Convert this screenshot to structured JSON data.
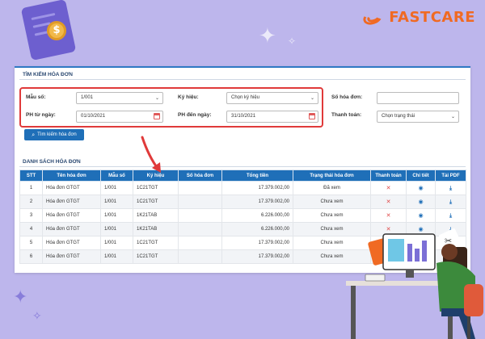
{
  "brand": {
    "name": "FASTCARE",
    "color": "#f06a23"
  },
  "search_section": {
    "title": "TÌM KIẾM HÓA ĐƠN",
    "fields": {
      "mau_so": {
        "label": "Mẫu số:",
        "value": "1/001"
      },
      "ky_hieu": {
        "label": "Ký hiệu:",
        "value": "Chọn ký hiệu"
      },
      "so_hoa_don": {
        "label": "Số hóa đơn:",
        "value": ""
      },
      "ph_tu_ngay": {
        "label": "PH từ ngày:",
        "value": "01/10/2021"
      },
      "ph_den_ngay": {
        "label": "PH đến ngày:",
        "value": "31/10/2021"
      },
      "thanh_toan": {
        "label": "Thanh toán:",
        "value": "Chọn trạng thái"
      }
    },
    "search_button": "Tìm kiếm hóa đơn"
  },
  "list_section": {
    "title": "DANH SÁCH HÓA ĐƠN",
    "columns": [
      "STT",
      "Tên hóa đơn",
      "Mẫu số",
      "Ký hiệu",
      "Số hóa đơn",
      "Tổng tiền",
      "Trạng thái hóa đơn",
      "Thanh toán",
      "Chi tiết",
      "Tải PDF"
    ],
    "rows": [
      {
        "stt": "1",
        "ten": "Hóa đơn GTGT",
        "mau_so": "1/001",
        "ky_hieu": "1C21TGT",
        "so": "",
        "tong_tien": "17.379.002,00",
        "trang_thai": "Đã xem"
      },
      {
        "stt": "2",
        "ten": "Hóa đơn GTGT",
        "mau_so": "1/001",
        "ky_hieu": "1C21TGT",
        "so": "",
        "tong_tien": "17.379.002,00",
        "trang_thai": "Chưa xem"
      },
      {
        "stt": "3",
        "ten": "Hóa đơn GTGT",
        "mau_so": "1/001",
        "ky_hieu": "1K21TAB",
        "so": "",
        "tong_tien": "6.226.000,00",
        "trang_thai": "Chưa xem"
      },
      {
        "stt": "4",
        "ten": "Hóa đơn GTGT",
        "mau_so": "1/001",
        "ky_hieu": "1K21TAB",
        "so": "",
        "tong_tien": "6.226.000,00",
        "trang_thai": "Chưa xem"
      },
      {
        "stt": "5",
        "ten": "Hóa đơn GTGT",
        "mau_so": "1/001",
        "ky_hieu": "1C21TGT",
        "so": "",
        "tong_tien": "17.379.002,00",
        "trang_thai": "Chưa xem"
      },
      {
        "stt": "6",
        "ten": "Hóa đơn GTGT",
        "mau_so": "1/001",
        "ky_hieu": "1C21TGT",
        "so": "",
        "tong_tien": "17.379.002,00",
        "trang_thai": "Chưa xem"
      }
    ]
  },
  "colors": {
    "primary": "#1f6fb8",
    "highlight": "#e03a3a",
    "background": "#bdb6ec"
  },
  "icons": {
    "payment": "close-icon",
    "detail": "eye-icon",
    "pdf": "download-icon",
    "search": "search-icon"
  }
}
